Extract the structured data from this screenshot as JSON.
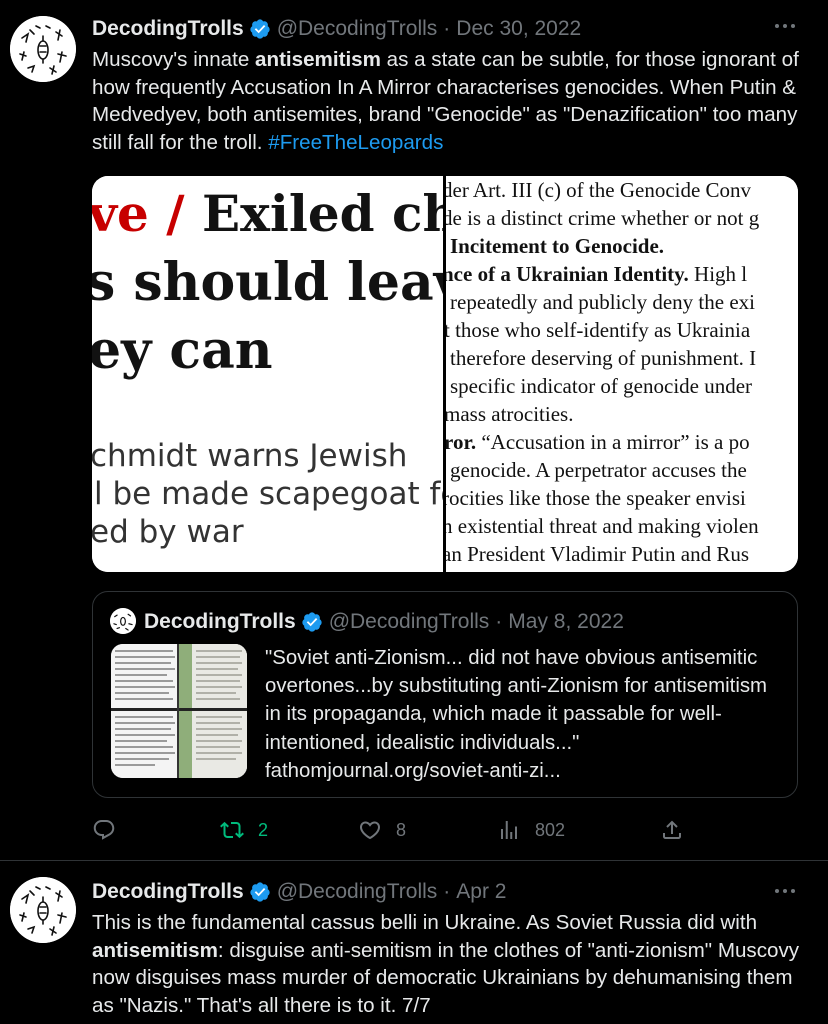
{
  "tweet1": {
    "name": "DecodingTrolls",
    "handle": "@DecodingTrolls",
    "separator": "·",
    "date": "Dec 30, 2022",
    "text_pre": "Muscovy's innate ",
    "text_bold": "antisemitism",
    "text_post": " as a state can be subtle, for those ignorant of how frequently Accusation In A Mirror characterises genocides. When Putin & Medvedyev, both antisemites, brand \"Genocide\" as \"Denazification\" too many still fall for the troll. ",
    "hashtag": "#FreeTheLeopards",
    "image_left": {
      "headline_red": "ve /",
      "headline_1": " Exiled chie",
      "headline_2": "s should leave",
      "headline_3": "ey can",
      "sub_1": "chmidt warns Jewish",
      "sub_2": "l be made scapegoat fo",
      "sub_3": "ed by war"
    },
    "image_right": {
      "line1": "der Art. III (c) of the Genocide Conv",
      "line2": "de is a distinct crime whether or not g",
      "line3": "Incitement to Genocide.",
      "line4_b": "nce of a Ukrainian Identity.",
      "line4": " High l",
      "line5": "repeatedly and publicly deny the exi",
      "line6": "t those who self-identify as Ukrainia",
      "line7": "therefore deserving of punishment. I",
      "line8": "specific indicator of genocide under",
      "line9": "mass atrocities.",
      "line10_b": "ror.",
      "line10": " “Accusation in a mirror” is a po",
      "line11": "genocide. A perpetrator accuses the",
      "line12": "rocities like those the speaker envisi",
      "line13": "n existential threat and making violen",
      "line14": "an President Vladimir Putin and Rus",
      "line15": ""
    },
    "quote": {
      "name": "DecodingTrolls",
      "handle": "@DecodingTrolls",
      "separator": "·",
      "date": "May 8, 2022",
      "text": "\"Soviet anti-Zionism... did not have obvious antisemitic overtones...by substituting anti-Zionism for antisemitism in its propaganda, which made it passable for well-intentioned, idealistic individuals...\" fathomjournal.org/soviet-anti-zi..."
    },
    "actions": {
      "replies": "",
      "retweets": "2",
      "likes": "8",
      "views": "802"
    }
  },
  "tweet2": {
    "name": "DecodingTrolls",
    "handle": "@DecodingTrolls",
    "separator": "·",
    "date": "Apr 2",
    "text_pre": "This is the fundamental cassus belli in Ukraine. As Soviet Russia did with ",
    "text_bold": "antisemitism",
    "text_post": ": disguise anti-semitism in the clothes of \"anti-zionism\" Muscovy now disguises mass murder of democratic Ukrainians by dehumanising them as \"Nazis.\" That's all there is to it. 7/7"
  },
  "colors": {
    "background": "#000000",
    "text": "#e7e9ea",
    "muted": "#71767b",
    "link": "#1d9bf0",
    "retweet": "#00ba7c",
    "verified": "#1d9bf0",
    "border": "#2f3336"
  },
  "icons": [
    "verified-badge-icon",
    "more-icon",
    "reply-icon",
    "retweet-icon",
    "like-icon",
    "views-icon",
    "share-icon"
  ]
}
